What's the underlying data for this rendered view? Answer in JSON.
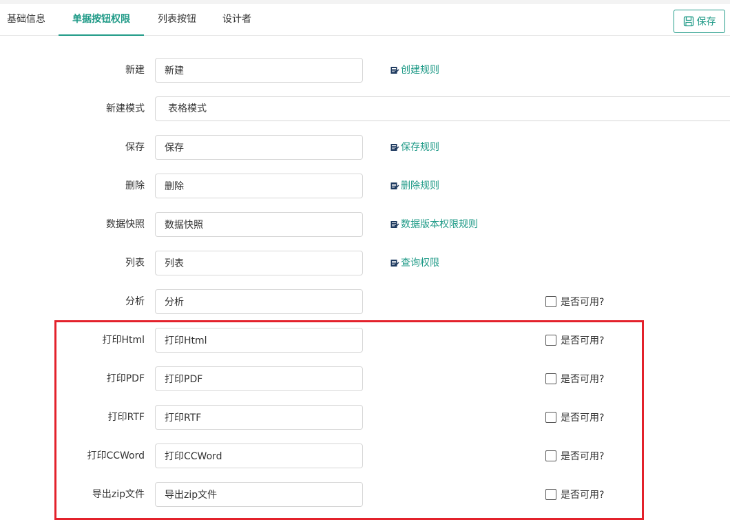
{
  "tabs": [
    {
      "label": "基础信息"
    },
    {
      "label": "单据按钮权限"
    },
    {
      "label": "列表按钮"
    },
    {
      "label": "设计者"
    }
  ],
  "toolbar": {
    "save_label": "保存"
  },
  "rows": [
    {
      "label": "新建",
      "value": "新建",
      "link": "创建规则"
    },
    {
      "label": "新建模式",
      "select_value": "表格模式"
    },
    {
      "label": "保存",
      "value": "保存",
      "link": "保存规则"
    },
    {
      "label": "删除",
      "value": "删除",
      "link": "删除规则"
    },
    {
      "label": "数据快照",
      "value": "数据快照",
      "link": "数据版本权限规则"
    },
    {
      "label": "列表",
      "value": "列表",
      "link": "查询权限"
    },
    {
      "label": "分析",
      "value": "分析",
      "checkbox": "是否可用?"
    },
    {
      "label": "打印Html",
      "value": "打印Html",
      "checkbox": "是否可用?"
    },
    {
      "label": "打印PDF",
      "value": "打印PDF",
      "checkbox": "是否可用?"
    },
    {
      "label": "打印RTF",
      "value": "打印RTF",
      "checkbox": "是否可用?"
    },
    {
      "label": "打印CCWord",
      "value": "打印CCWord",
      "checkbox": "是否可用?"
    },
    {
      "label": "导出zip文件",
      "value": "导出zip文件",
      "checkbox": "是否可用?"
    }
  ],
  "colors": {
    "accent": "#1f9a87",
    "highlight": "#e3212b"
  },
  "icons": {
    "save": "floppy-disk-icon",
    "rule": "edit-note-icon"
  }
}
